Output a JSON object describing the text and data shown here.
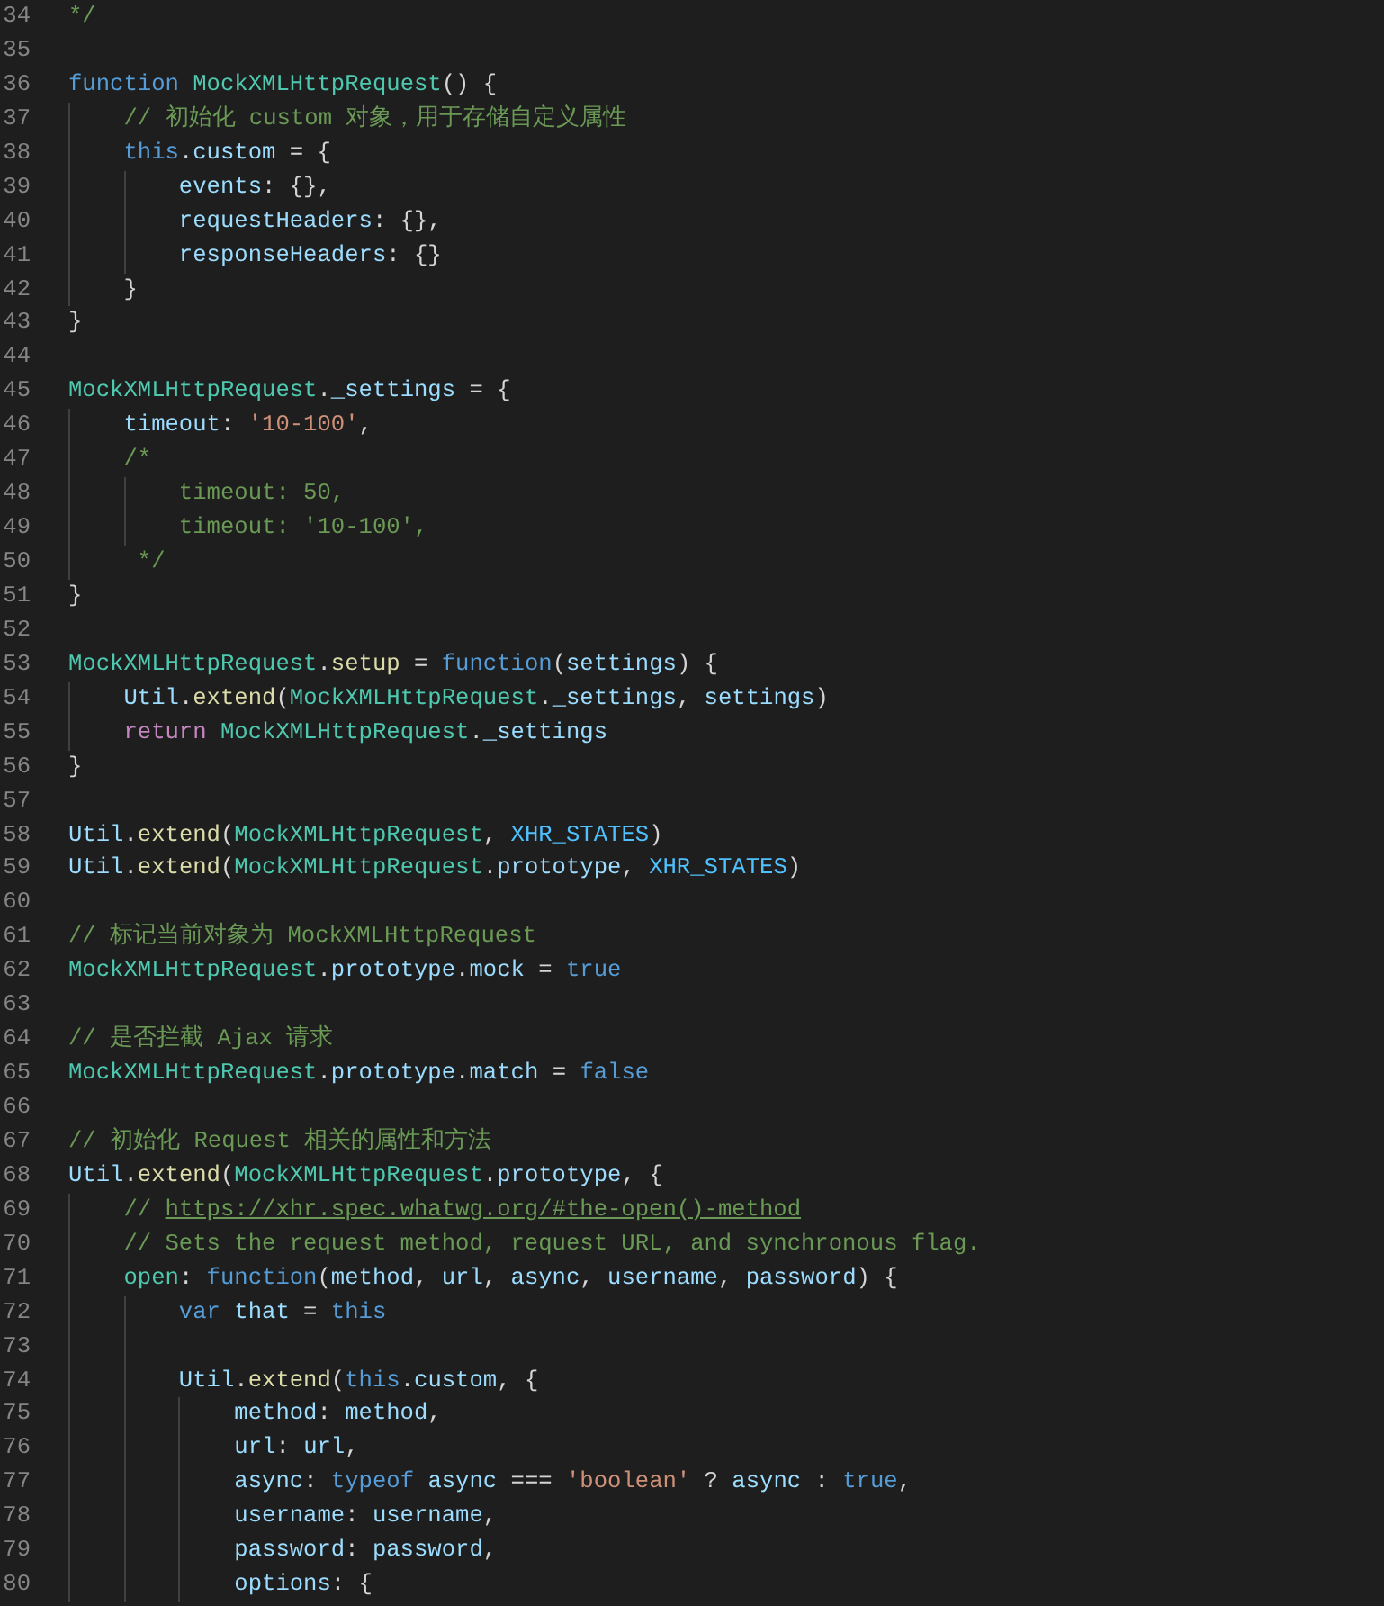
{
  "editor": {
    "lines": [
      {
        "number": "34",
        "tokens": [
          {
            "kind": "comment",
            "text": "*/"
          }
        ]
      },
      {
        "number": "35"
      },
      {
        "number": "36",
        "tokens": [
          {
            "kind": "keyword",
            "text": "function "
          },
          {
            "kind": "class",
            "text": "MockXMLHttpRequest"
          },
          {
            "kind": "plain",
            "text": "() {"
          }
        ]
      },
      {
        "number": "37",
        "tokens": [
          {
            "kind": "comment",
            "text": "    // 初始化 custom 对象，用于存储自定义属性"
          }
        ]
      },
      {
        "number": "38",
        "tokens": [
          {
            "kind": "keyword",
            "text": "    this"
          },
          {
            "kind": "plain",
            "text": "."
          },
          {
            "kind": "property",
            "text": "custom"
          },
          {
            "kind": "plain",
            "text": " = {"
          }
        ]
      },
      {
        "number": "39",
        "tokens": [
          {
            "kind": "property",
            "text": "        events"
          },
          {
            "kind": "plain",
            "text": ": {},"
          }
        ]
      },
      {
        "number": "40",
        "tokens": [
          {
            "kind": "property",
            "text": "        requestHeaders"
          },
          {
            "kind": "plain",
            "text": ": {},"
          }
        ]
      },
      {
        "number": "41",
        "tokens": [
          {
            "kind": "property",
            "text": "        responseHeaders"
          },
          {
            "kind": "plain",
            "text": ": {}"
          }
        ]
      },
      {
        "number": "42",
        "tokens": [
          {
            "kind": "plain",
            "text": "    }"
          }
        ]
      },
      {
        "number": "43",
        "tokens": [
          {
            "kind": "plain",
            "text": "}"
          }
        ]
      },
      {
        "number": "44"
      },
      {
        "number": "45",
        "tokens": [
          {
            "kind": "class",
            "text": "MockXMLHttpRequest"
          },
          {
            "kind": "plain",
            "text": "."
          },
          {
            "kind": "property",
            "text": "_settings"
          },
          {
            "kind": "plain",
            "text": " = {"
          }
        ]
      },
      {
        "number": "46",
        "tokens": [
          {
            "kind": "property",
            "text": "    timeout"
          },
          {
            "kind": "plain",
            "text": ": "
          },
          {
            "kind": "string",
            "text": "'10-100'"
          },
          {
            "kind": "plain",
            "text": ","
          }
        ]
      },
      {
        "number": "47",
        "tokens": [
          {
            "kind": "comment",
            "text": "    /*"
          }
        ]
      },
      {
        "number": "48",
        "tokens": [
          {
            "kind": "comment",
            "text": "        timeout: 50,"
          }
        ]
      },
      {
        "number": "49",
        "tokens": [
          {
            "kind": "comment",
            "text": "        timeout: '10-100',"
          }
        ]
      },
      {
        "number": "50",
        "tokens": [
          {
            "kind": "comment",
            "text": "     */"
          }
        ]
      },
      {
        "number": "51",
        "tokens": [
          {
            "kind": "plain",
            "text": "}"
          }
        ]
      },
      {
        "number": "52"
      },
      {
        "number": "53",
        "tokens": [
          {
            "kind": "class",
            "text": "MockXMLHttpRequest"
          },
          {
            "kind": "plain",
            "text": "."
          },
          {
            "kind": "function",
            "text": "setup"
          },
          {
            "kind": "plain",
            "text": " = "
          },
          {
            "kind": "keyword",
            "text": "function"
          },
          {
            "kind": "plain",
            "text": "("
          },
          {
            "kind": "property",
            "text": "settings"
          },
          {
            "kind": "plain",
            "text": ") {"
          }
        ]
      },
      {
        "number": "54",
        "tokens": [
          {
            "kind": "property",
            "text": "    Util"
          },
          {
            "kind": "plain",
            "text": "."
          },
          {
            "kind": "function",
            "text": "extend"
          },
          {
            "kind": "plain",
            "text": "("
          },
          {
            "kind": "class",
            "text": "MockXMLHttpRequest"
          },
          {
            "kind": "plain",
            "text": "."
          },
          {
            "kind": "property",
            "text": "_settings"
          },
          {
            "kind": "plain",
            "text": ", "
          },
          {
            "kind": "property",
            "text": "settings"
          },
          {
            "kind": "plain",
            "text": ")"
          }
        ]
      },
      {
        "number": "55",
        "tokens": [
          {
            "kind": "control",
            "text": "    return "
          },
          {
            "kind": "class",
            "text": "MockXMLHttpRequest"
          },
          {
            "kind": "plain",
            "text": "."
          },
          {
            "kind": "property",
            "text": "_settings"
          }
        ]
      },
      {
        "number": "56",
        "tokens": [
          {
            "kind": "plain",
            "text": "}"
          }
        ]
      },
      {
        "number": "57"
      },
      {
        "number": "58",
        "tokens": [
          {
            "kind": "property",
            "text": "Util"
          },
          {
            "kind": "plain",
            "text": "."
          },
          {
            "kind": "function",
            "text": "extend"
          },
          {
            "kind": "plain",
            "text": "("
          },
          {
            "kind": "class",
            "text": "MockXMLHttpRequest"
          },
          {
            "kind": "plain",
            "text": ", "
          },
          {
            "kind": "constant",
            "text": "XHR_STATES"
          },
          {
            "kind": "plain",
            "text": ")"
          }
        ]
      },
      {
        "number": "59",
        "tokens": [
          {
            "kind": "property",
            "text": "Util"
          },
          {
            "kind": "plain",
            "text": "."
          },
          {
            "kind": "function",
            "text": "extend"
          },
          {
            "kind": "plain",
            "text": "("
          },
          {
            "kind": "class",
            "text": "MockXMLHttpRequest"
          },
          {
            "kind": "plain",
            "text": "."
          },
          {
            "kind": "property",
            "text": "prototype"
          },
          {
            "kind": "plain",
            "text": ", "
          },
          {
            "kind": "constant",
            "text": "XHR_STATES"
          },
          {
            "kind": "plain",
            "text": ")"
          }
        ]
      },
      {
        "number": "60"
      },
      {
        "number": "61",
        "tokens": [
          {
            "kind": "comment",
            "text": "// 标记当前对象为 MockXMLHttpRequest"
          }
        ]
      },
      {
        "number": "62",
        "tokens": [
          {
            "kind": "class",
            "text": "MockXMLHttpRequest"
          },
          {
            "kind": "plain",
            "text": "."
          },
          {
            "kind": "property",
            "text": "prototype"
          },
          {
            "kind": "plain",
            "text": "."
          },
          {
            "kind": "property",
            "text": "mock"
          },
          {
            "kind": "plain",
            "text": " = "
          },
          {
            "kind": "keyword",
            "text": "true"
          }
        ]
      },
      {
        "number": "63"
      },
      {
        "number": "64",
        "tokens": [
          {
            "kind": "comment",
            "text": "// 是否拦截 Ajax 请求"
          }
        ]
      },
      {
        "number": "65",
        "tokens": [
          {
            "kind": "class",
            "text": "MockXMLHttpRequest"
          },
          {
            "kind": "plain",
            "text": "."
          },
          {
            "kind": "property",
            "text": "prototype"
          },
          {
            "kind": "plain",
            "text": "."
          },
          {
            "kind": "property",
            "text": "match"
          },
          {
            "kind": "plain",
            "text": " = "
          },
          {
            "kind": "keyword",
            "text": "false"
          }
        ]
      },
      {
        "number": "66"
      },
      {
        "number": "67",
        "tokens": [
          {
            "kind": "comment",
            "text": "// 初始化 Request 相关的属性和方法"
          }
        ]
      },
      {
        "number": "68",
        "tokens": [
          {
            "kind": "property",
            "text": "Util"
          },
          {
            "kind": "plain",
            "text": "."
          },
          {
            "kind": "function",
            "text": "extend"
          },
          {
            "kind": "plain",
            "text": "("
          },
          {
            "kind": "class",
            "text": "MockXMLHttpRequest"
          },
          {
            "kind": "plain",
            "text": "."
          },
          {
            "kind": "property",
            "text": "prototype"
          },
          {
            "kind": "plain",
            "text": ", {"
          }
        ]
      },
      {
        "number": "69",
        "tokens": [
          {
            "kind": "comment",
            "text": "    // "
          },
          {
            "kind": "link",
            "text": "https://xhr.spec.whatwg.org/#the-open()-method"
          }
        ]
      },
      {
        "number": "70",
        "tokens": [
          {
            "kind": "comment",
            "text": "    // Sets the request method, request URL, and synchronous flag."
          }
        ]
      },
      {
        "number": "71",
        "tokens": [
          {
            "kind": "class",
            "text": "    open"
          },
          {
            "kind": "plain",
            "text": ": "
          },
          {
            "kind": "keyword",
            "text": "function"
          },
          {
            "kind": "plain",
            "text": "("
          },
          {
            "kind": "property",
            "text": "method"
          },
          {
            "kind": "plain",
            "text": ", "
          },
          {
            "kind": "property",
            "text": "url"
          },
          {
            "kind": "plain",
            "text": ", "
          },
          {
            "kind": "property",
            "text": "async"
          },
          {
            "kind": "plain",
            "text": ", "
          },
          {
            "kind": "property",
            "text": "username"
          },
          {
            "kind": "plain",
            "text": ", "
          },
          {
            "kind": "property",
            "text": "password"
          },
          {
            "kind": "plain",
            "text": ") {"
          }
        ]
      },
      {
        "number": "72",
        "tokens": [
          {
            "kind": "keyword",
            "text": "        var "
          },
          {
            "kind": "property",
            "text": "that"
          },
          {
            "kind": "plain",
            "text": " = "
          },
          {
            "kind": "keyword",
            "text": "this"
          }
        ]
      },
      {
        "number": "73"
      },
      {
        "number": "74",
        "tokens": [
          {
            "kind": "property",
            "text": "        Util"
          },
          {
            "kind": "plain",
            "text": "."
          },
          {
            "kind": "function",
            "text": "extend"
          },
          {
            "kind": "plain",
            "text": "("
          },
          {
            "kind": "keyword",
            "text": "this"
          },
          {
            "kind": "plain",
            "text": "."
          },
          {
            "kind": "property",
            "text": "custom"
          },
          {
            "kind": "plain",
            "text": ", {"
          }
        ]
      },
      {
        "number": "75",
        "tokens": [
          {
            "kind": "property",
            "text": "            method"
          },
          {
            "kind": "plain",
            "text": ": "
          },
          {
            "kind": "property",
            "text": "method"
          },
          {
            "kind": "plain",
            "text": ","
          }
        ]
      },
      {
        "number": "76",
        "tokens": [
          {
            "kind": "property",
            "text": "            url"
          },
          {
            "kind": "plain",
            "text": ": "
          },
          {
            "kind": "property",
            "text": "url"
          },
          {
            "kind": "plain",
            "text": ","
          }
        ]
      },
      {
        "number": "77",
        "tokens": [
          {
            "kind": "property",
            "text": "            async"
          },
          {
            "kind": "plain",
            "text": ": "
          },
          {
            "kind": "keyword",
            "text": "typeof "
          },
          {
            "kind": "property",
            "text": "async"
          },
          {
            "kind": "plain",
            "text": " === "
          },
          {
            "kind": "string",
            "text": "'boolean'"
          },
          {
            "kind": "plain",
            "text": " ? "
          },
          {
            "kind": "property",
            "text": "async"
          },
          {
            "kind": "plain",
            "text": " : "
          },
          {
            "kind": "keyword",
            "text": "true"
          },
          {
            "kind": "plain",
            "text": ","
          }
        ]
      },
      {
        "number": "78",
        "tokens": [
          {
            "kind": "property",
            "text": "            username"
          },
          {
            "kind": "plain",
            "text": ": "
          },
          {
            "kind": "property",
            "text": "username"
          },
          {
            "kind": "plain",
            "text": ","
          }
        ]
      },
      {
        "number": "79",
        "tokens": [
          {
            "kind": "property",
            "text": "            password"
          },
          {
            "kind": "plain",
            "text": ": "
          },
          {
            "kind": "property",
            "text": "password"
          },
          {
            "kind": "plain",
            "text": ","
          }
        ]
      },
      {
        "number": "80",
        "tokens": [
          {
            "kind": "property",
            "text": "            options"
          },
          {
            "kind": "plain",
            "text": ": {"
          }
        ]
      }
    ]
  }
}
